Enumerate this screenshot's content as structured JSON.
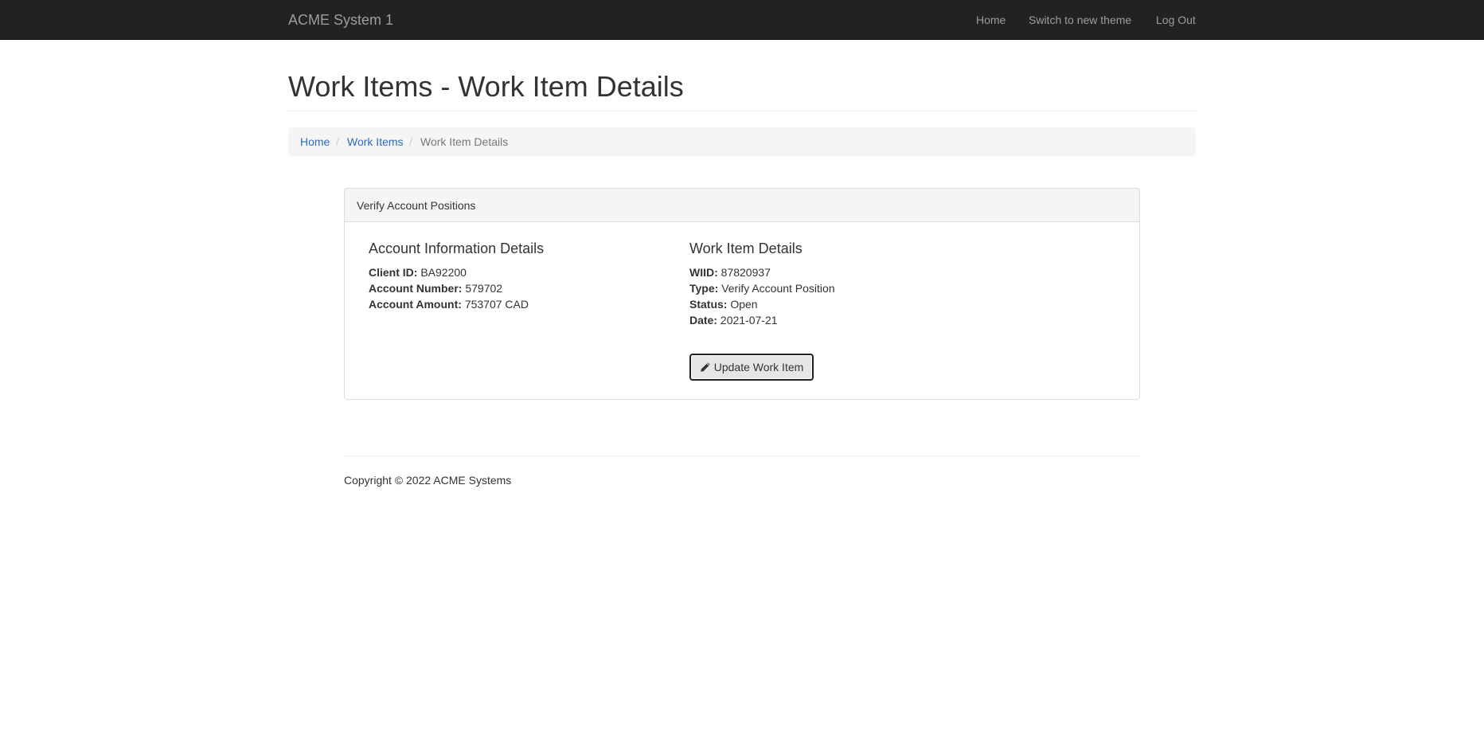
{
  "navbar": {
    "brand": "ACME System 1",
    "links": [
      "Home",
      "Switch to new theme",
      "Log Out"
    ]
  },
  "page": {
    "title": "Work Items - Work Item Details"
  },
  "breadcrumb": {
    "items": [
      "Home",
      "Work Items",
      "Work Item Details"
    ],
    "separator": "/"
  },
  "panel": {
    "heading": "Verify Account Positions",
    "account": {
      "title": "Account Information Details",
      "fields": [
        {
          "label": "Client ID:",
          "value": "BA92200"
        },
        {
          "label": "Account Number:",
          "value": "579702"
        },
        {
          "label": "Account Amount:",
          "value": "753707 CAD"
        }
      ]
    },
    "work_item": {
      "title": "Work Item Details",
      "fields": [
        {
          "label": "WIID:",
          "value": "87820937"
        },
        {
          "label": "Type:",
          "value": "Verify Account Position"
        },
        {
          "label": "Status:",
          "value": "Open"
        },
        {
          "label": "Date:",
          "value": "2021-07-21"
        }
      ],
      "button_label": "Update Work Item",
      "button_icon": "pencil-icon"
    }
  },
  "footer": {
    "text": "Copyright © 2022 ACME Systems"
  },
  "colors": {
    "navbar_bg": "#222222",
    "link": "#2a6ebb",
    "panel_heading_bg": "#f5f5f5"
  }
}
